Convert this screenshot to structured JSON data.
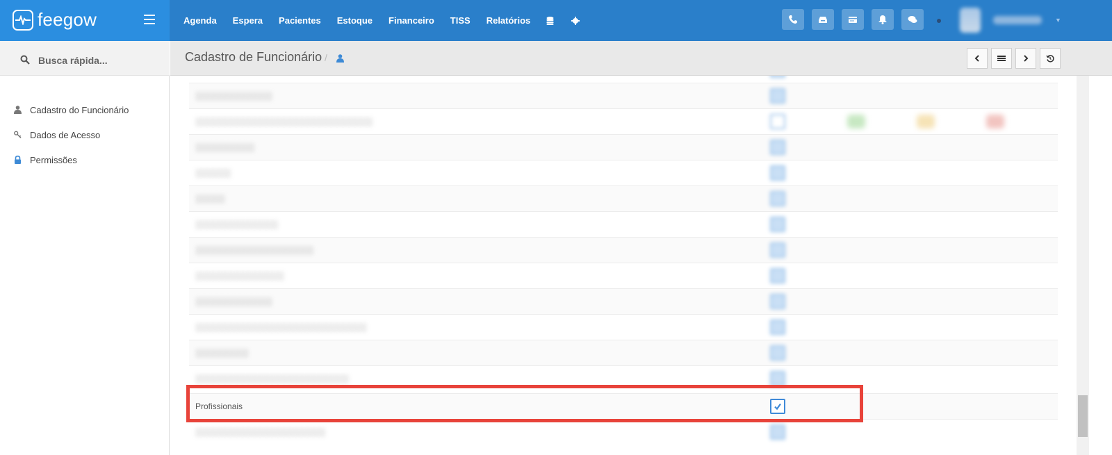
{
  "brand": {
    "name": "feegow"
  },
  "nav": {
    "items": [
      "Agenda",
      "Espera",
      "Pacientes",
      "Estoque",
      "Financeiro",
      "TISS",
      "Relatórios"
    ],
    "extra_icons": [
      "database-icon",
      "gear-icon"
    ]
  },
  "top_buttons": [
    "phone-icon",
    "inbox-icon",
    "card-icon",
    "bell-icon",
    "chat-icon"
  ],
  "sidebar": {
    "search_placeholder": "Busca rápida...",
    "items": [
      {
        "label": "Cadastro do Funcionário",
        "icon": "user-icon"
      },
      {
        "label": "Dados de Acesso",
        "icon": "key-icon"
      },
      {
        "label": "Permissões",
        "icon": "lock-icon"
      }
    ]
  },
  "page": {
    "title": "Cadastro de Funcionário",
    "breadcrumb_separator": "/",
    "pager_icons": [
      "chevron-left-icon",
      "list-icon",
      "chevron-right-icon",
      "history-icon"
    ]
  },
  "permissions": {
    "highlighted_label": "Profissionais",
    "highlighted_checked": true,
    "highlight_color": "#e8433a",
    "accent_color": "#2a7fca"
  }
}
